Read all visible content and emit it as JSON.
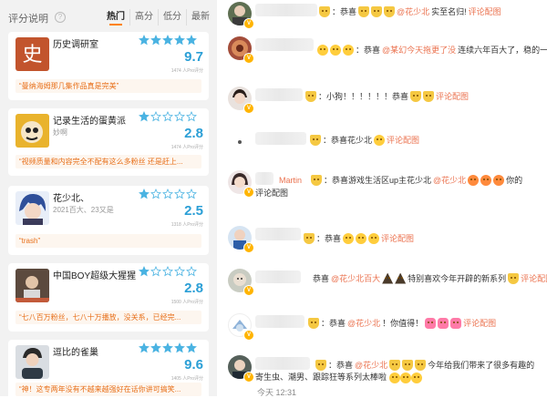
{
  "header": {
    "title": "评分说明",
    "help_icon": "?"
  },
  "tabs": [
    "热门",
    "高分",
    "低分",
    "最新"
  ],
  "cards": [
    {
      "name": "历史调研室",
      "sub": "",
      "score": "9.7",
      "count": "1474 人Pro评分",
      "quote": "“曼纳海姆那几集作品真是完美”",
      "avatar_glyph": "史",
      "avatar_color": "#c2542d",
      "stars": 5
    },
    {
      "name": "记录生活的蛋黄派",
      "sub": "妙啊",
      "score": "2.8",
      "count": "1474 人Pro评分",
      "quote": "“视频质量和内容完全不配有这么多粉丝 还是赶上...",
      "avatar_color": "#e9b32c",
      "stars": 1
    },
    {
      "name": "花少北、",
      "sub": "2021百大、23又是",
      "score": "2.5",
      "count": "1318 人Pro评分",
      "quote": "“trash”",
      "avatar_color": "#4a76c8",
      "stars": 1
    },
    {
      "name": "中国BOY超级大猩猩",
      "sub": "",
      "score": "2.8",
      "count": "1500 人Pro评分",
      "quote": "“七八百万粉丝，七八十万播放，没关系，已经完...",
      "avatar_color": "#8a6e5a",
      "stars": 1
    },
    {
      "name": "逗比的雀巢",
      "sub": "",
      "score": "9.6",
      "count": "1405 人Pro评分",
      "quote": "“神！这专两年没有不越来越强好在话你讲可搞笑...",
      "avatar_color": "#5a6b7a",
      "stars": 5
    }
  ],
  "comments": [
    {
      "pre": "：恭喜",
      "mention": "花少北",
      "mid": "",
      "mention2": "@花少北",
      "post": "实至名归!",
      "link": "评论配图"
    },
    {
      "pre": "：恭喜",
      "mention": "@某幻今天拖更了没",
      "mid": "",
      "mention2": "",
      "post": "连续六年百大了，稳的一比",
      "link": ""
    },
    {
      "pre": "：小狗！！！！！！恭喜",
      "mention": "",
      "mid": "",
      "mention2": "",
      "post": "",
      "link": "评论配图"
    },
    {
      "pre": "：恭喜花少北",
      "mention": "",
      "mid": "",
      "mention2": "",
      "post": "",
      "link": "评论配图"
    },
    {
      "pre": "Martin",
      "mention": "",
      "mid": "：恭喜游戏生活区up主花少北",
      "mention2": "@花少北",
      "post": "你的",
      "link": "评论配图"
    },
    {
      "pre": "：恭喜",
      "mention": "",
      "mid": "",
      "mention2": "",
      "post": "",
      "link": "评论配图"
    },
    {
      "pre": "恭喜",
      "mention": "@花少北百大",
      "mid": "",
      "mention2": "",
      "post": "特别喜欢今年开辟的新系列",
      "link": "评论配图"
    },
    {
      "pre": "：恭喜",
      "mention": "@花少北",
      "mid": "",
      "mention2": "",
      "post": "！你值得！",
      "link": "评论配图"
    },
    {
      "pre": "：恭喜",
      "mention": "@花少北",
      "mid": "",
      "mention2": "",
      "post": "今年给我们带来了很多有趣的",
      "link": "",
      "extra": "寄生虫、潮男、跟踪狂等系列太棒啦"
    }
  ],
  "timestamp": "今天 12:31"
}
